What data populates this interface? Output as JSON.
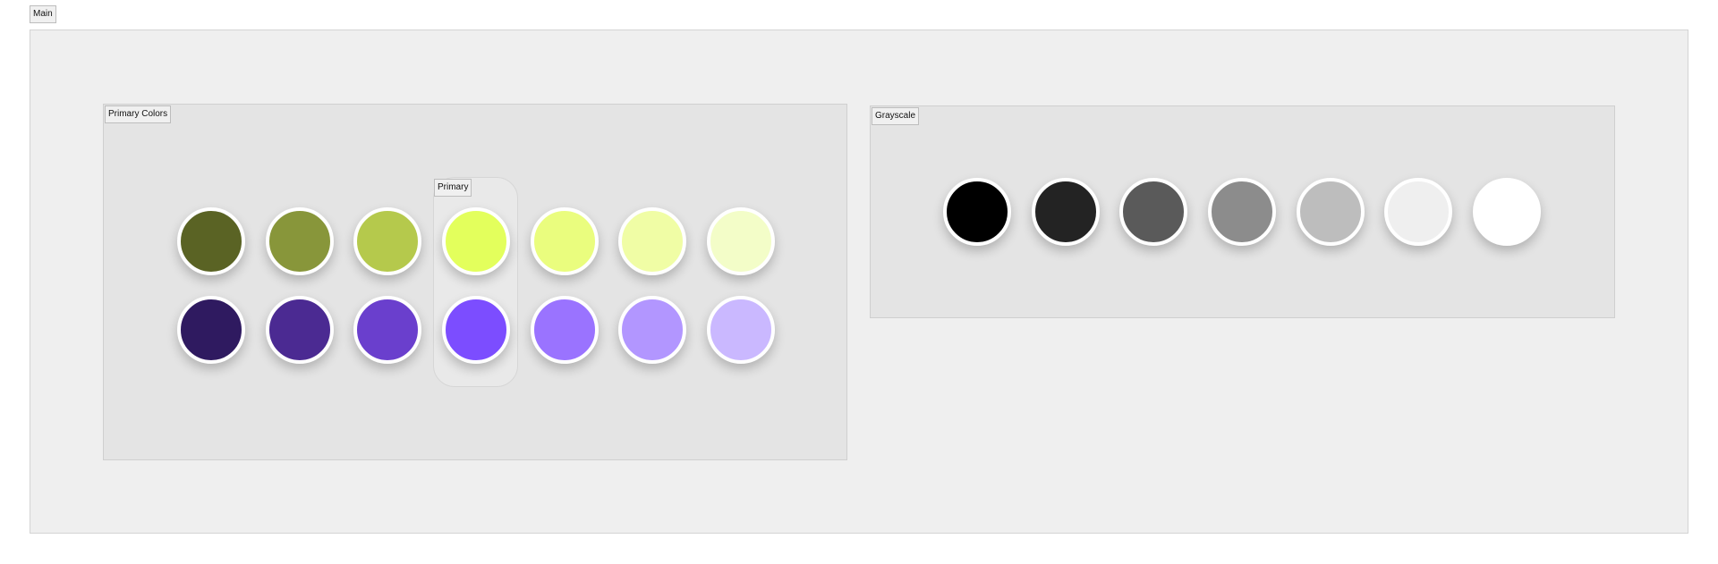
{
  "main": {
    "label": "Main"
  },
  "primary_colors": {
    "label": "Primary Colors",
    "group_label": "Primary",
    "row1": [
      "#5a6324",
      "#88963a",
      "#b5c94c",
      "#e3ff5c",
      "#eafd7e",
      "#f0fda5",
      "#f3fdc8"
    ],
    "row2": [
      "#2f1a60",
      "#4b2a92",
      "#6a3fcd",
      "#7c4dff",
      "#9a73ff",
      "#b296ff",
      "#cab8ff"
    ]
  },
  "grayscale": {
    "label": "Grayscale",
    "swatches": [
      "#000000",
      "#232323",
      "#5a5a5a",
      "#8c8c8c",
      "#bdbdbd",
      "#efefef",
      "#ffffff"
    ]
  }
}
